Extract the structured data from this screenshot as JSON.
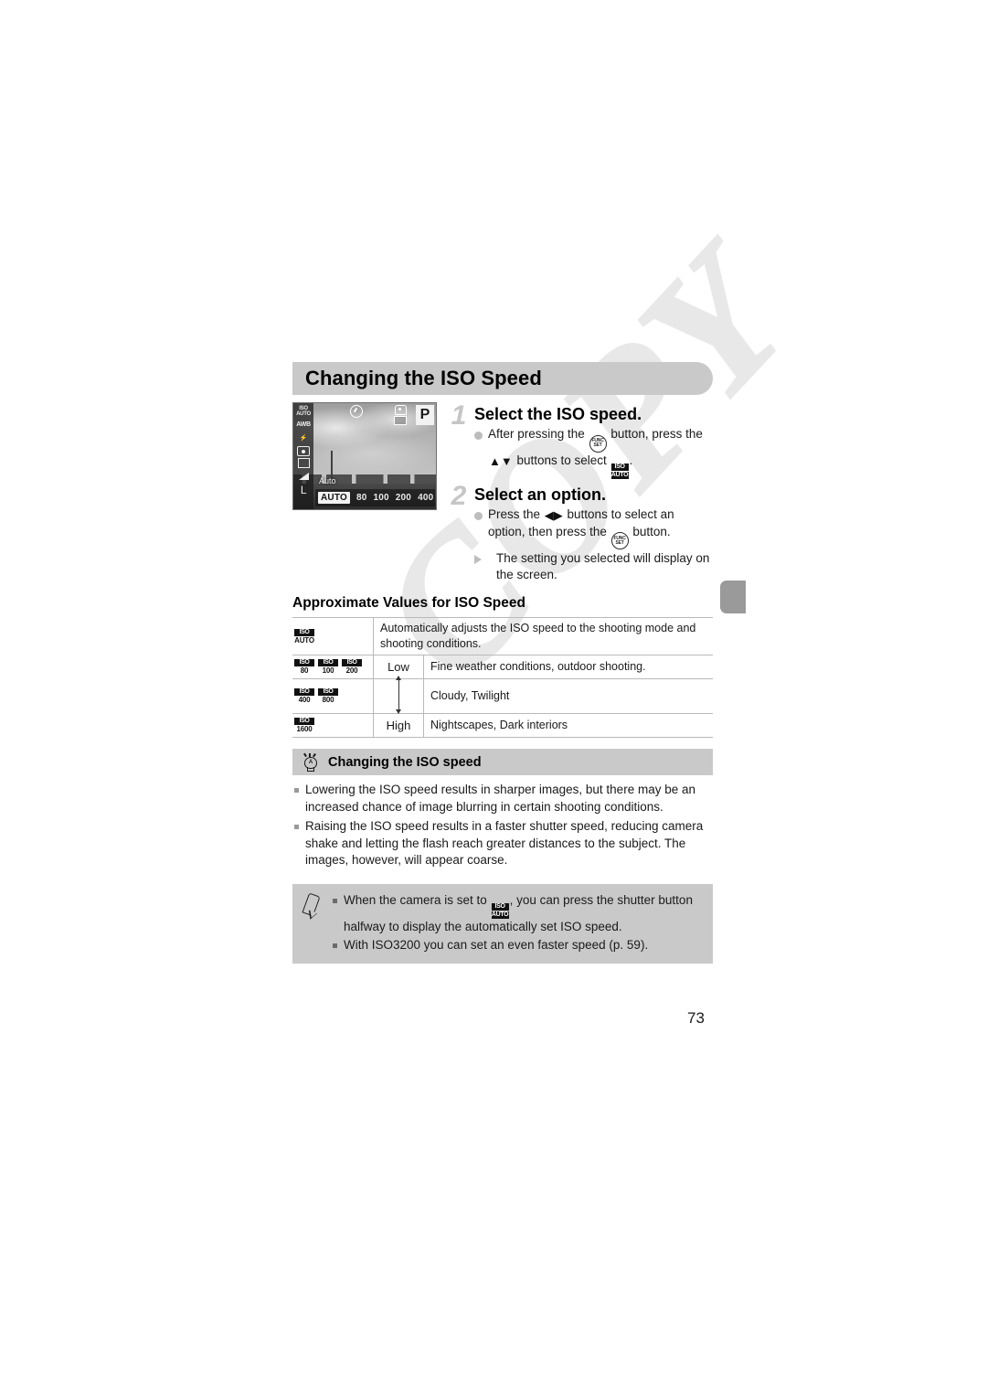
{
  "page": {
    "number": "73"
  },
  "watermark": {
    "text": "COPY"
  },
  "heading": {
    "title": "Changing the ISO Speed"
  },
  "camera_screen": {
    "mode_icon": "P",
    "auto_label": "Auto",
    "iso_options": [
      "AUTO",
      "80",
      "100",
      "200",
      "400"
    ],
    "selected_option": "AUTO",
    "next_arrow": "▸",
    "left_icons": [
      {
        "name": "iso-auto-indicator",
        "top": "ISO",
        "bottom": "AUTO"
      },
      {
        "name": "white-balance-icon",
        "label": "AWB"
      },
      {
        "name": "flash-off-icon",
        "label": "⚡"
      },
      {
        "name": "metering-mode-icon",
        "label": ""
      },
      {
        "name": "drive-mode-icon",
        "label": ""
      },
      {
        "name": "compression-icon",
        "label": ""
      },
      {
        "name": "image-size-icon",
        "label": "L"
      }
    ]
  },
  "steps": [
    {
      "number": "1",
      "title": "Select the ISO speed.",
      "lines": [
        {
          "marker": "dot",
          "parts": [
            {
              "t": "text",
              "v": "After pressing the "
            },
            {
              "t": "icon",
              "v": "func-set-button"
            },
            {
              "t": "text",
              "v": " button, press the "
            },
            {
              "t": "icon",
              "v": "up-down-buttons"
            },
            {
              "t": "text",
              "v": " buttons to select "
            },
            {
              "t": "icon",
              "v": "iso-auto-icon"
            },
            {
              "t": "text",
              "v": "."
            }
          ]
        }
      ]
    },
    {
      "number": "2",
      "title": "Select an option.",
      "lines": [
        {
          "marker": "dot",
          "parts": [
            {
              "t": "text",
              "v": "Press the "
            },
            {
              "t": "icon",
              "v": "left-right-buttons"
            },
            {
              "t": "text",
              "v": " buttons to select an option, then press the "
            },
            {
              "t": "icon",
              "v": "func-set-button"
            },
            {
              "t": "text",
              "v": " button."
            }
          ]
        },
        {
          "marker": "triangle",
          "parts": [
            {
              "t": "text",
              "v": "The setting you selected will display on the screen."
            }
          ]
        }
      ]
    }
  ],
  "step1_text_a": "After pressing the ",
  "step1_text_b": " button, press the ",
  "step1_text_c": " buttons to select ",
  "step1_text_d": ".",
  "step2_text_a": "Press the ",
  "step2_text_b": " buttons to select an option, then press the ",
  "step2_text_c": " button.",
  "step2_text_d": "The setting you selected will display on the screen.",
  "table": {
    "title": "Approximate Values for ISO Speed",
    "rows": [
      {
        "icons": [
          {
            "cap": "ISO",
            "val": "AUTO"
          }
        ],
        "level": "",
        "description": "Automatically adjusts the ISO speed to the shooting mode and shooting conditions."
      },
      {
        "icons": [
          {
            "cap": "ISO",
            "val": "80"
          },
          {
            "cap": "ISO",
            "val": "100"
          },
          {
            "cap": "ISO",
            "val": "200"
          }
        ],
        "level": "Low",
        "description": "Fine weather conditions, outdoor shooting."
      },
      {
        "icons": [
          {
            "cap": "ISO",
            "val": "400"
          },
          {
            "cap": "ISO",
            "val": "800"
          }
        ],
        "level": "",
        "description": "Cloudy, Twilight"
      },
      {
        "icons": [
          {
            "cap": "ISO",
            "val": "1600"
          }
        ],
        "level": "High",
        "description": "Nightscapes, Dark interiors"
      }
    ]
  },
  "tip": {
    "icon": "lightbulb-icon",
    "bulb_letter": "A",
    "title": "Changing the ISO speed",
    "items": [
      "Lowering the ISO speed results in sharper images, but there may be an increased chance of image blurring in certain shooting conditions.",
      "Raising the ISO speed results in a faster shutter speed, reducing camera shake and letting the flash reach greater distances to the subject. The images, however, will appear coarse."
    ]
  },
  "note": {
    "icon": "pencil-icon",
    "item1_a": "When the camera is set to ",
    "item1_b": ", you can press the shutter button halfway to display the automatically set ISO speed.",
    "item2": "With ISO3200 you can set an even faster speed (p. 59)."
  },
  "icons": {
    "func_set_top": "FUNC",
    "func_set_bottom": "SET",
    "iso_cap": "ISO",
    "iso_auto": "AUTO",
    "up_down": "▲▼",
    "left_right": "◀▶"
  }
}
